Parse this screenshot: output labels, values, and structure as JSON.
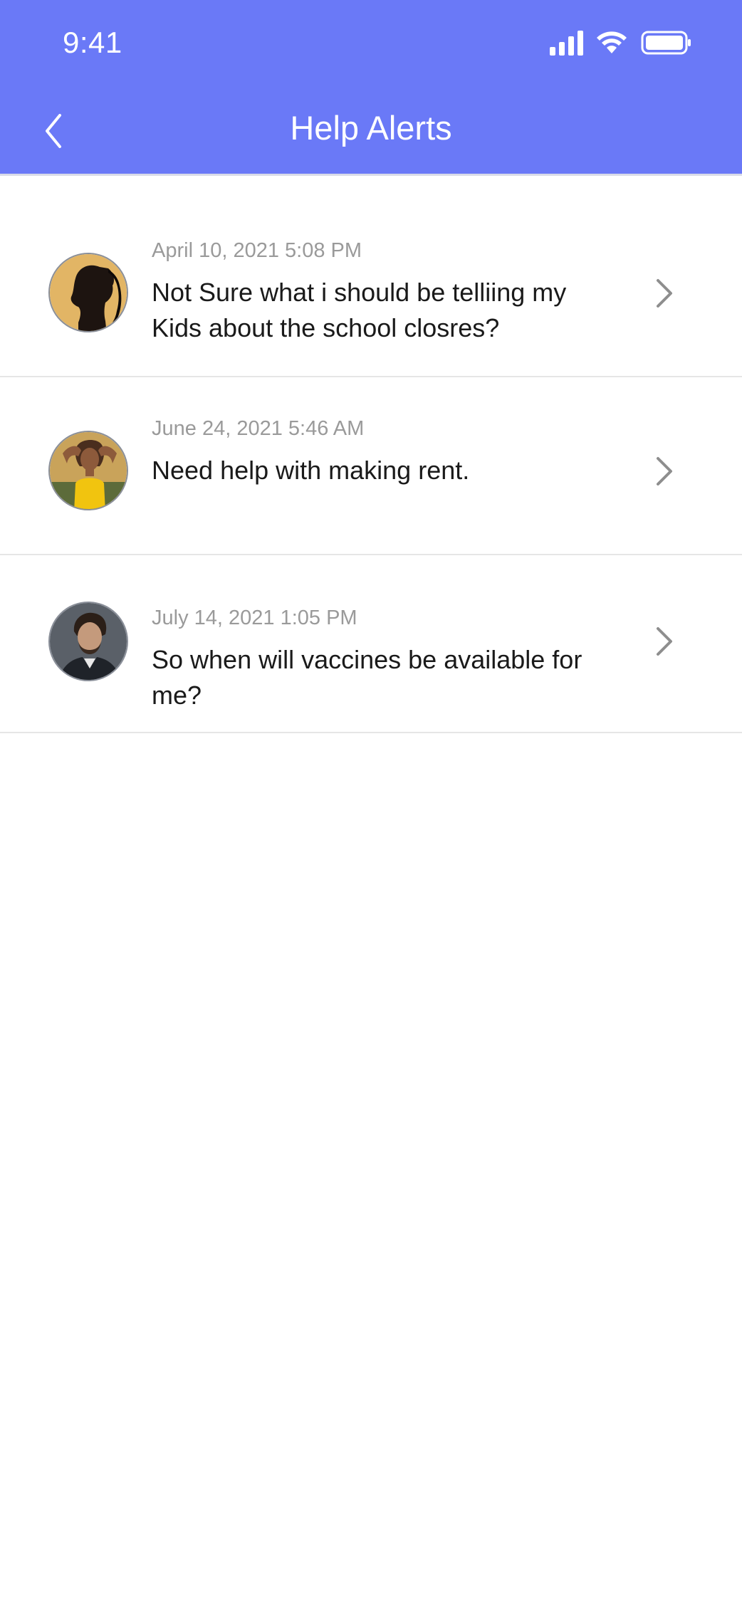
{
  "status_bar": {
    "time": "9:41"
  },
  "nav": {
    "title": "Help Alerts",
    "back_icon": "chevron-left-icon"
  },
  "colors": {
    "header_bg": "#6a79f7",
    "date_text": "#9a9a9a",
    "message_text": "#1a1a1a",
    "divider": "#e6e6e6",
    "chevron": "#8e8e8e"
  },
  "alerts": [
    {
      "date": "April 10, 2021 5:08 PM",
      "message": "Not Sure what i should be telliing my Kids about the school closres?",
      "avatar": "woman-profile-avatar"
    },
    {
      "date": "June 24, 2021 5:46 AM",
      "message": "Need help with making rent.",
      "avatar": "woman-yellow-top-avatar"
    },
    {
      "date": "July 14, 2021 1:05 PM",
      "message": "So when will vaccines be available for me?",
      "avatar": "man-dark-jacket-avatar"
    }
  ]
}
